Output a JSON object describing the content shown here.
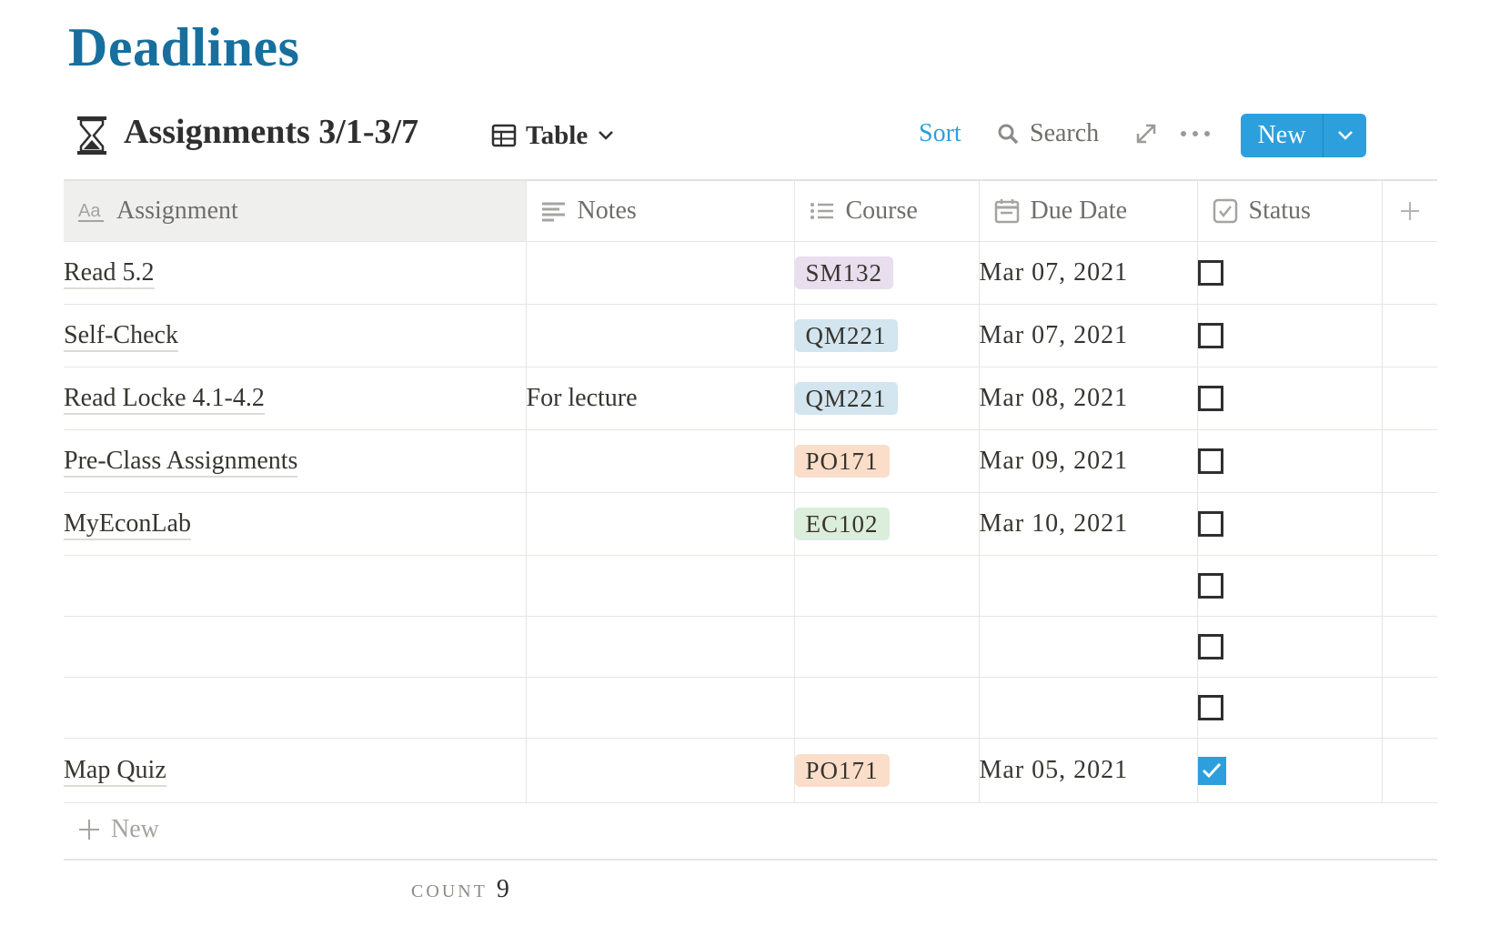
{
  "page": {
    "title": "Deadlines"
  },
  "database": {
    "icon": "hourglass-icon",
    "title": "Assignments 3/1-3/7",
    "view": {
      "icon": "table-icon",
      "label": "Table"
    }
  },
  "toolbar": {
    "sort_label": "Sort",
    "search_label": "Search",
    "new_label": "New",
    "accent_color": "#2d9fdc"
  },
  "columns": [
    {
      "name": "Assignment",
      "icon": "text-title-icon"
    },
    {
      "name": "Notes",
      "icon": "text-lines-icon"
    },
    {
      "name": "Course",
      "icon": "list-icon"
    },
    {
      "name": "Due Date",
      "icon": "calendar-icon"
    },
    {
      "name": "Status",
      "icon": "checkbox-icon"
    }
  ],
  "rows": [
    {
      "assignment": "Read 5.2",
      "notes": "",
      "course": "SM132",
      "course_color": "#e8deee",
      "due": "Mar 07, 2021",
      "done": false
    },
    {
      "assignment": "Self-Check",
      "notes": "",
      "course": "QM221",
      "course_color": "#d3e5ef",
      "due": "Mar 07, 2021",
      "done": false
    },
    {
      "assignment": "Read Locke 4.1-4.2",
      "notes": "For lecture",
      "course": "QM221",
      "course_color": "#d3e5ef",
      "due": "Mar 08, 2021",
      "done": false
    },
    {
      "assignment": "Pre-Class Assignments",
      "notes": "",
      "course": "PO171",
      "course_color": "#fadec9",
      "due": "Mar 09, 2021",
      "done": false
    },
    {
      "assignment": "MyEconLab",
      "notes": "",
      "course": "EC102",
      "course_color": "#dbeddb",
      "due": "Mar 10, 2021",
      "done": false
    },
    {
      "assignment": "",
      "notes": "",
      "course": "",
      "course_color": "",
      "due": "",
      "done": false
    },
    {
      "assignment": "",
      "notes": "",
      "course": "",
      "course_color": "",
      "due": "",
      "done": false
    },
    {
      "assignment": "",
      "notes": "",
      "course": "",
      "course_color": "",
      "due": "",
      "done": false
    },
    {
      "assignment": "Map Quiz",
      "notes": "",
      "course": "PO171",
      "course_color": "#fadec9",
      "due": "Mar 05, 2021",
      "done": true
    }
  ],
  "footer": {
    "new_row_label": "New",
    "count_label": "COUNT",
    "count_value": "9"
  }
}
